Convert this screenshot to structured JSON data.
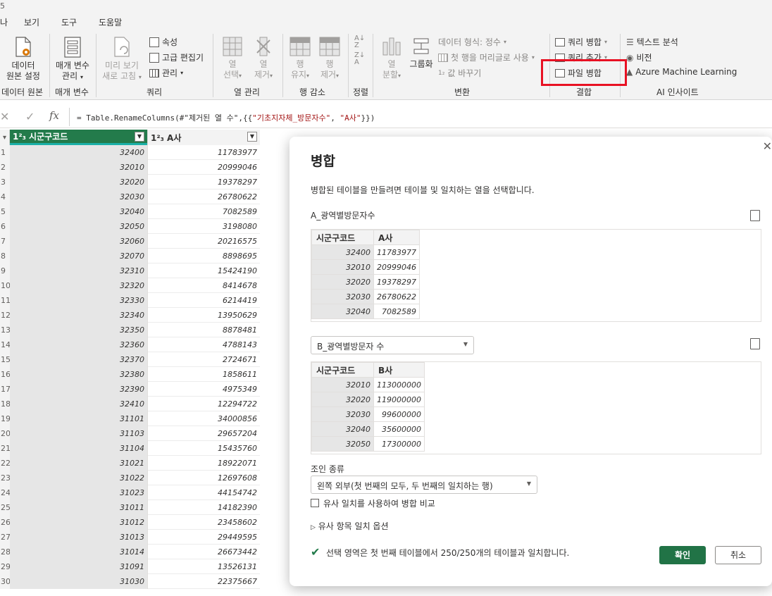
{
  "menu": {
    "cut_num": "5",
    "cut_left": "나",
    "view": "보기",
    "tools": "도구",
    "help": "도움말"
  },
  "ribbon": {
    "datasource_line1": "데이터",
    "datasource_line2": "원본 설정",
    "datasource_group": "데이터 원본",
    "param_line1": "매개 변수",
    "param_line2": "관리",
    "param_group": "매개 변수",
    "preview_line1": "미리 보기",
    "preview_line2": "새로 고침",
    "properties": "속성",
    "advanced_editor": "고급 편집기",
    "manage": "관리",
    "query_group": "쿼리",
    "choose_cols_1": "열",
    "choose_cols_2": "선택",
    "remove_cols_1": "열",
    "remove_cols_2": "제거",
    "col_group": "열 관리",
    "keep_rows_1": "행",
    "keep_rows_2": "유지",
    "remove_rows_1": "행",
    "remove_rows_2": "제거",
    "row_group": "행 감소",
    "sort_group": "정렬",
    "split_1": "열",
    "split_2": "분할",
    "groupby": "그룹화",
    "data_type": "데이터 형식: 정수",
    "first_row_header": "첫 행을 머리글로 사용",
    "replace_values": "값 바꾸기",
    "transform_group": "변환",
    "merge_queries": "쿼리 병합",
    "append_queries": "쿼리 추가",
    "combine_files": "파일 병합",
    "combine_group": "결합",
    "text_analytics": "텍스트 분석",
    "vision": "비전",
    "azure_ml": "Azure Machine Learning",
    "ai_group": "AI 인사이트"
  },
  "formula": {
    "prefix": "= Table.RenameColumns(#\"제거된 열 수\",{{",
    "str1": "\"기초지자체_방문자수\"",
    "sep": ", ",
    "str2": "\"A사\"",
    "suffix": "}})"
  },
  "grid": {
    "col1_header": "1²₃ 시군구코드",
    "col2_header": "1²₃ A사",
    "rows": [
      {
        "n": "1",
        "code": "32400",
        "a": "11783977"
      },
      {
        "n": "2",
        "code": "32010",
        "a": "20999046"
      },
      {
        "n": "3",
        "code": "32020",
        "a": "19378297"
      },
      {
        "n": "4",
        "code": "32030",
        "a": "26780622"
      },
      {
        "n": "5",
        "code": "32040",
        "a": "7082589"
      },
      {
        "n": "6",
        "code": "32050",
        "a": "3198080"
      },
      {
        "n": "7",
        "code": "32060",
        "a": "20216575"
      },
      {
        "n": "8",
        "code": "32070",
        "a": "8898695"
      },
      {
        "n": "9",
        "code": "32310",
        "a": "15424190"
      },
      {
        "n": "10",
        "code": "32320",
        "a": "8414678"
      },
      {
        "n": "11",
        "code": "32330",
        "a": "6214419"
      },
      {
        "n": "12",
        "code": "32340",
        "a": "13950629"
      },
      {
        "n": "13",
        "code": "32350",
        "a": "8878481"
      },
      {
        "n": "14",
        "code": "32360",
        "a": "4788143"
      },
      {
        "n": "15",
        "code": "32370",
        "a": "2724671"
      },
      {
        "n": "16",
        "code": "32380",
        "a": "1858611"
      },
      {
        "n": "17",
        "code": "32390",
        "a": "4975349"
      },
      {
        "n": "18",
        "code": "32410",
        "a": "12294722"
      },
      {
        "n": "19",
        "code": "31101",
        "a": "34000856"
      },
      {
        "n": "20",
        "code": "31103",
        "a": "29657204"
      },
      {
        "n": "21",
        "code": "31104",
        "a": "15435760"
      },
      {
        "n": "22",
        "code": "31021",
        "a": "18922071"
      },
      {
        "n": "23",
        "code": "31022",
        "a": "12697608"
      },
      {
        "n": "24",
        "code": "31023",
        "a": "44154742"
      },
      {
        "n": "25",
        "code": "31011",
        "a": "14182390"
      },
      {
        "n": "26",
        "code": "31012",
        "a": "23458602"
      },
      {
        "n": "27",
        "code": "31013",
        "a": "29449595"
      },
      {
        "n": "28",
        "code": "31014",
        "a": "26673442"
      },
      {
        "n": "29",
        "code": "31091",
        "a": "13526131"
      },
      {
        "n": "30",
        "code": "31030",
        "a": "22375667"
      }
    ]
  },
  "dialog": {
    "title": "병합",
    "description": "병합된 테이블을 만들려면 테이블 및 일치하는 열을 선택합니다.",
    "table1_name": "A_광역별방문자수",
    "table1_headers": [
      "시군구코드",
      "A사"
    ],
    "table1_rows": [
      [
        "32400",
        "11783977"
      ],
      [
        "32010",
        "20999046"
      ],
      [
        "32020",
        "19378297"
      ],
      [
        "32030",
        "26780622"
      ],
      [
        "32040",
        "7082589"
      ]
    ],
    "table2_select": "B_광역별방문자 수",
    "table2_headers": [
      "시군구코드",
      "B사"
    ],
    "table2_rows": [
      [
        "32010",
        "113000000"
      ],
      [
        "32020",
        "119000000"
      ],
      [
        "32030",
        "99600000"
      ],
      [
        "32040",
        "35600000"
      ],
      [
        "32050",
        "17300000"
      ]
    ],
    "join_label": "조인 종류",
    "join_value": "왼쪽 외부(첫 번째의 모두, 두 번째의 일치하는 행)",
    "fuzzy_checkbox": "유사 일치를 사용하여 병합 비교",
    "fuzzy_options": "유사 항목 일치 옵션",
    "status": "선택 영역은 첫 번째 테이블에서 250/250개의 테이블과 일치합니다.",
    "ok": "확인",
    "cancel": "취소"
  },
  "colors": {
    "accent_green": "#217346",
    "highlight_red": "#e81123",
    "header_green": "#237b4b"
  }
}
